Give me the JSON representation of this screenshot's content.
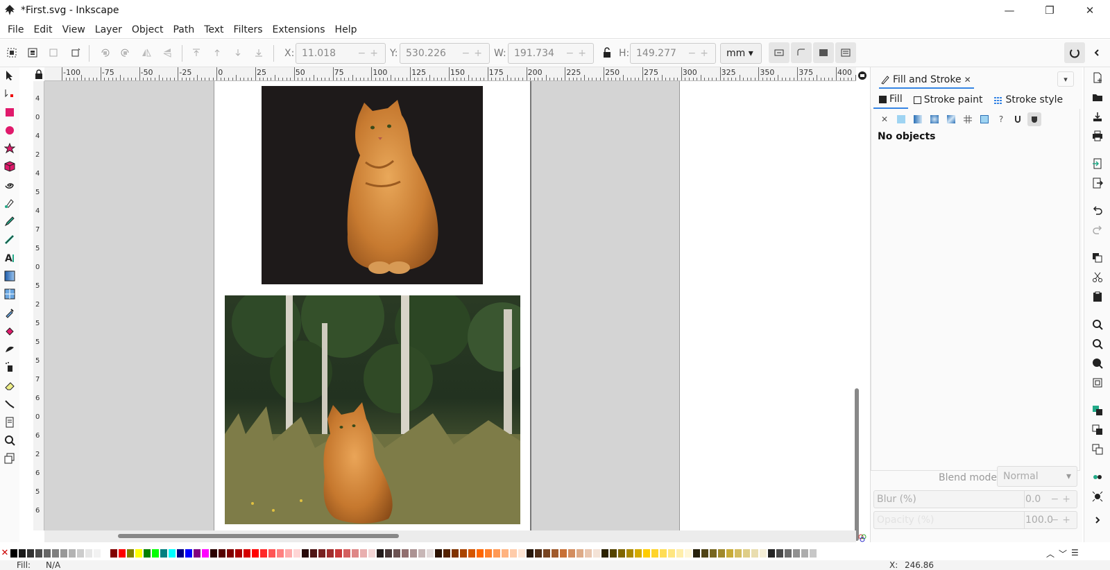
{
  "window": {
    "title": "*First.svg - Inkscape",
    "minimize": "—",
    "maximize": "❐",
    "close": "✕"
  },
  "menu": [
    "File",
    "Edit",
    "View",
    "Layer",
    "Object",
    "Path",
    "Text",
    "Filters",
    "Extensions",
    "Help"
  ],
  "toolbar": {
    "x_label": "X:",
    "x_value": "11.018",
    "y_label": "Y:",
    "y_value": "530.226",
    "w_label": "W:",
    "w_value": "191.734",
    "h_label": "H:",
    "h_value": "149.277",
    "unit": "mm"
  },
  "ruler_top_labels": [
    "-100",
    "-75",
    "-50",
    "-25",
    "0",
    "25",
    "50",
    "75",
    "100",
    "125",
    "150",
    "175",
    "200",
    "225",
    "250",
    "275",
    "300",
    "325",
    "350",
    "375",
    "400"
  ],
  "ruler_left_labels": [
    "4",
    "0",
    "4",
    "2",
    "4",
    "5",
    "4",
    "7",
    "5",
    "0",
    "5",
    "2",
    "5",
    "5",
    "5",
    "7",
    "6",
    "0",
    "6",
    "2",
    "6",
    "5",
    "6"
  ],
  "panel": {
    "tab_title": "Fill and Stroke",
    "tabs": [
      "Fill",
      "Stroke paint",
      "Stroke style"
    ],
    "no_objects": "No objects",
    "blend_label": "Blend mode:",
    "blend_value": "Normal",
    "blur_label": "Blur (%)",
    "blur_value": "0.0",
    "opacity_label": "Opacity (%)",
    "opacity_value": "100.0"
  },
  "palette_colors": [
    "#000000",
    "#1a1a1a",
    "#333333",
    "#4d4d4d",
    "#666666",
    "#808080",
    "#999999",
    "#b3b3b3",
    "#cccccc",
    "#e6e6e6",
    "#f2f2f2",
    "#ffffff",
    "#800000",
    "#ff0000",
    "#808000",
    "#ffff00",
    "#008000",
    "#00ff00",
    "#008080",
    "#00ffff",
    "#000080",
    "#0000ff",
    "#800080",
    "#ff00ff",
    "#2b0000",
    "#550000",
    "#800000",
    "#aa0000",
    "#d40000",
    "#ff0000",
    "#ff2a2a",
    "#ff5555",
    "#ff8080",
    "#ffaaaa",
    "#ffd5d5",
    "#280b0b",
    "#501616",
    "#782121",
    "#a02c2c",
    "#c83737",
    "#d35f5f",
    "#de8787",
    "#e9afaf",
    "#f4d7d7",
    "#241c1c",
    "#483737",
    "#6c5353",
    "#916f6f",
    "#ac9393",
    "#c8b7b7",
    "#e3dbdb",
    "#2b1100",
    "#552200",
    "#803300",
    "#aa4400",
    "#d45500",
    "#ff6600",
    "#ff7f2a",
    "#ff9955",
    "#ffb380",
    "#ffccaa",
    "#ffe6d5",
    "#28170b",
    "#502d16",
    "#784421",
    "#a05a2c",
    "#c87137",
    "#d38d5f",
    "#deaa87",
    "#e9c6af",
    "#f4e3d7",
    "#2b2200",
    "#554400",
    "#806600",
    "#aa8800",
    "#d4aa00",
    "#ffcc00",
    "#ffd42a",
    "#ffdd55",
    "#ffe680",
    "#ffeeaa",
    "#fff6d5",
    "#28220b",
    "#504416",
    "#786721",
    "#a0892c",
    "#c8ab37",
    "#d3bc5f",
    "#decd87",
    "#e9ddaf",
    "#f4eed7",
    "#242424",
    "#484848",
    "#6c6c6c",
    "#919191",
    "#acacac",
    "#c8c8c8"
  ],
  "status": {
    "fill_label": "Fill:",
    "fill_value": "N/A",
    "coord_x_label": "X:",
    "coord_x_value": "246.86"
  }
}
